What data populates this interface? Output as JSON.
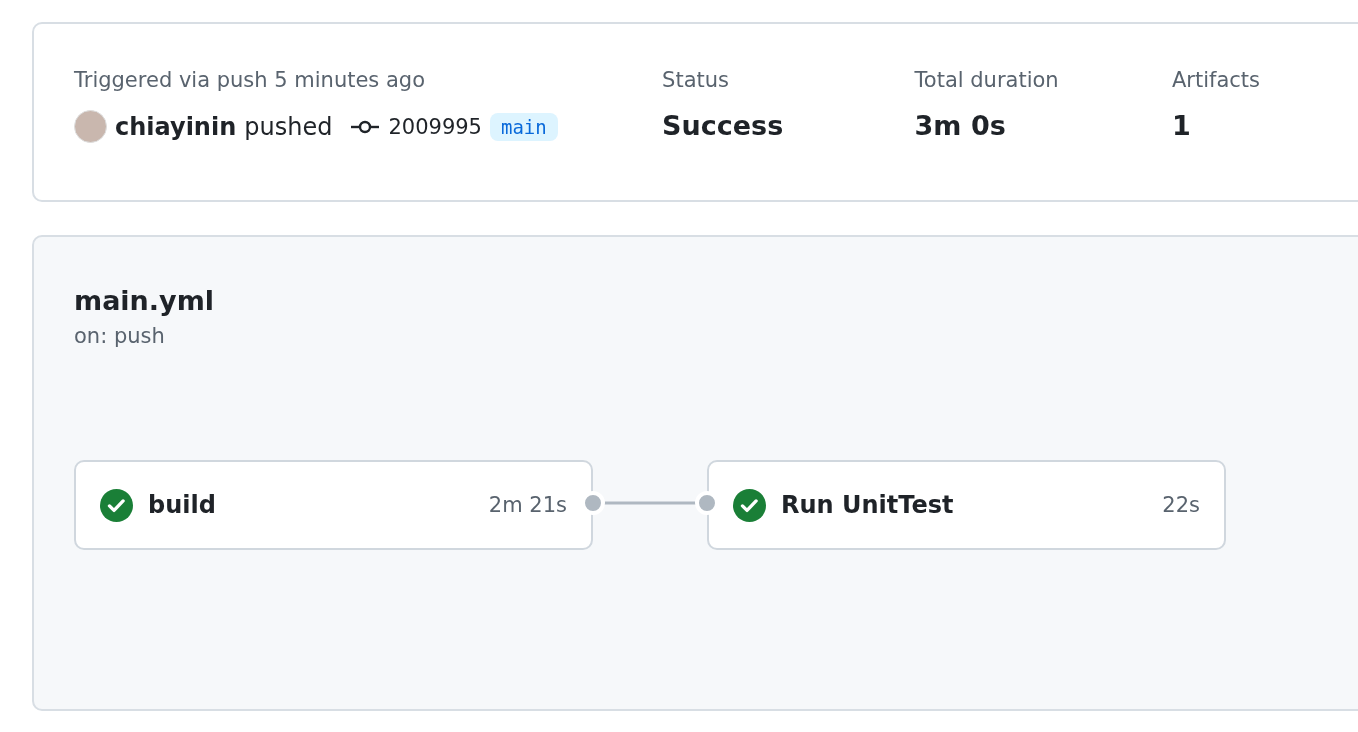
{
  "run": {
    "trigger": "Triggered via push 5 minutes ago",
    "actor": "chiayinin",
    "action": "pushed",
    "commit": "2009995",
    "branch": "main"
  },
  "summary": [
    {
      "label": "Status",
      "value": "Success"
    },
    {
      "label": "Total duration",
      "value": "3m 0s"
    },
    {
      "label": "Artifacts",
      "value": "1"
    }
  ],
  "workflow": {
    "name": "main.yml",
    "trigger": "on: push",
    "jobs": [
      {
        "name": "build",
        "duration": "2m 21s",
        "kind": "success"
      },
      {
        "name": "Run UnitTest",
        "duration": "22s",
        "kind": "success"
      }
    ]
  }
}
